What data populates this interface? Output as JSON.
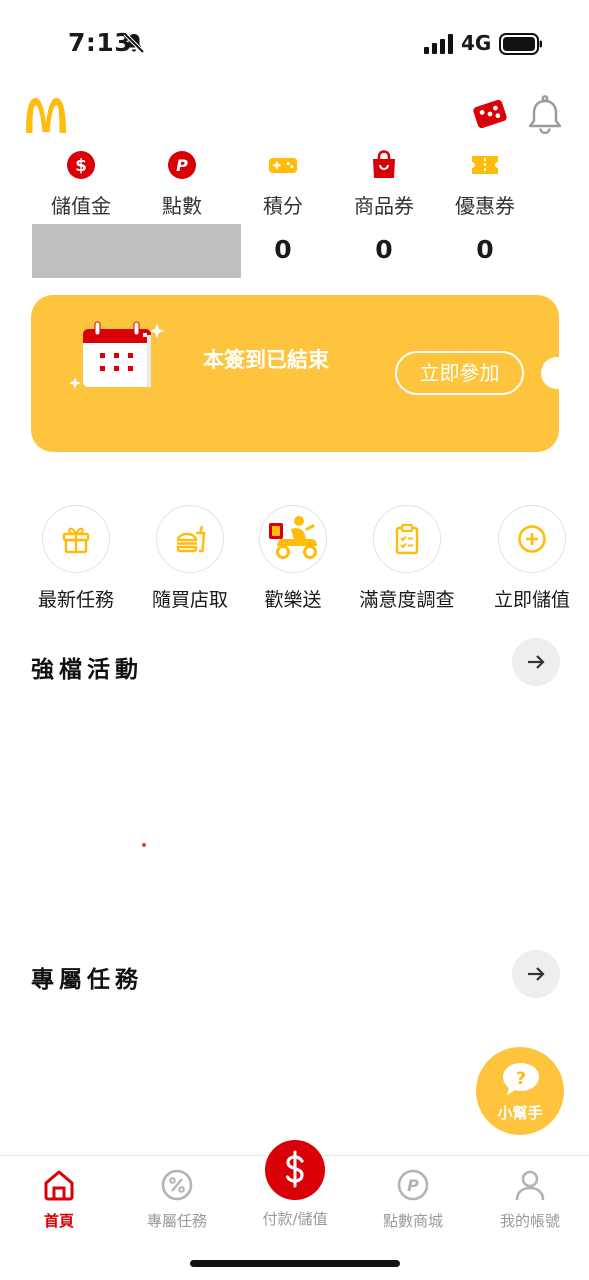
{
  "status_bar": {
    "time": "7:13",
    "network": "4G",
    "icons": [
      "bell-off-icon",
      "signal-icon",
      "battery-icon"
    ]
  },
  "header": {
    "logo": "mcdonalds-logo",
    "icons": [
      "dice-promo-icon",
      "notification-bell-icon"
    ]
  },
  "wallet": [
    {
      "label": "儲值金",
      "value": "",
      "icon": "dollar-coin-icon"
    },
    {
      "label": "點數",
      "value": "",
      "icon": "point-coin-icon"
    },
    {
      "label": "積分",
      "value": "0",
      "icon": "game-controller-icon"
    },
    {
      "label": "商品券",
      "value": "0",
      "icon": "shopping-bag-icon"
    },
    {
      "label": "優惠券",
      "value": "0",
      "icon": "ticket-icon"
    }
  ],
  "checkin_banner": {
    "title": "本簽到已結束",
    "button": "立即參加"
  },
  "quick_actions": [
    {
      "label": "最新任務",
      "icon": "gift-icon"
    },
    {
      "label": "隨買店取",
      "icon": "burger-drink-icon"
    },
    {
      "label": "歡樂送",
      "icon": "delivery-scooter-icon"
    },
    {
      "label": "滿意度調查",
      "icon": "clipboard-icon"
    },
    {
      "label": "立即儲值",
      "icon": "plus-circle-icon"
    }
  ],
  "sections": {
    "featured": "強檔活動",
    "exclusive": "專屬任務"
  },
  "helper": {
    "label": "小幫手",
    "icon": "question-chat-icon"
  },
  "bottom_nav": {
    "home": "首頁",
    "tasks": "專屬任務",
    "pay": "付款/儲值",
    "mall": "點數商城",
    "account": "我的帳號"
  },
  "colors": {
    "brand_red": "#d90007",
    "brand_yellow": "#ffc43e",
    "mcd_gold": "#ffbc0d"
  }
}
